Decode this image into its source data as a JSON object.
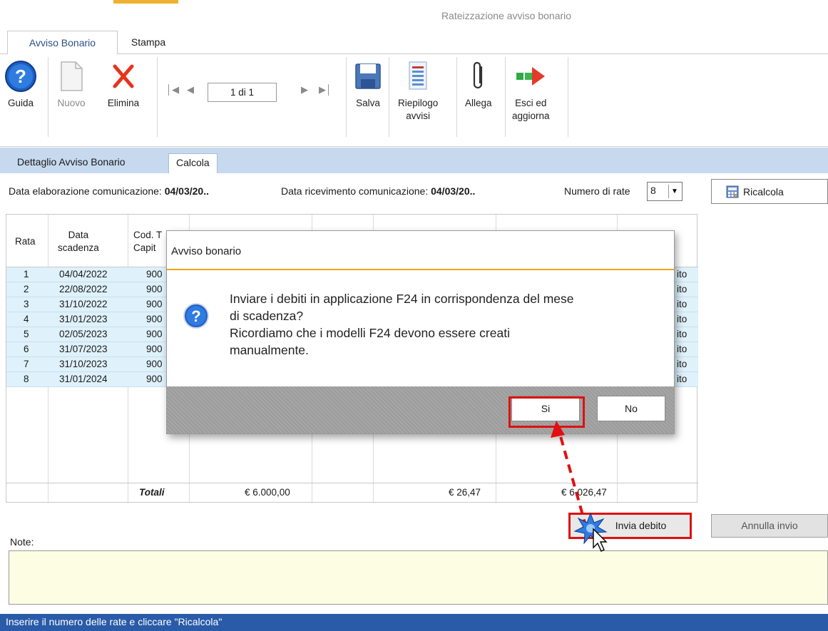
{
  "window": {
    "title": "Rateizzazione avviso bonario"
  },
  "ribbon_tabs": [
    "Avviso Bonario",
    "Stampa"
  ],
  "ribbon": {
    "guida": "Guida",
    "nuovo": "Nuovo",
    "elimina": "Elimina",
    "record_nav": "1 di 1",
    "salva": "Salva",
    "riepilogo_line1": "Riepilogo",
    "riepilogo_line2": "avvisi",
    "allega": "Allega",
    "esci_line1": "Esci ed",
    "esci_line2": "aggiorna"
  },
  "form_tabs": [
    "Dettaglio Avviso Bonario",
    "Calcola"
  ],
  "data_row": {
    "elab_label": "Data elaborazione comunicazione:",
    "elab_value": "04/03/20..",
    "ricev_label": "Data ricevimento comunicazione:",
    "ricev_value": "04/03/20..",
    "rate_label": "Numero di rate",
    "rate_value": "8",
    "ricalcola": "Ricalcola"
  },
  "table": {
    "headers": {
      "rata": "Rata",
      "data_line1": "Data",
      "data_line2": "scadenza",
      "cod_line1": "Cod. T",
      "cod_line2": "Capit"
    },
    "rows": [
      {
        "rata": "1",
        "data": "04/04/2022",
        "cod": "900",
        "tail": "ito"
      },
      {
        "rata": "2",
        "data": "22/08/2022",
        "cod": "900",
        "tail": "ito"
      },
      {
        "rata": "3",
        "data": "31/10/2022",
        "cod": "900",
        "tail": "ito"
      },
      {
        "rata": "4",
        "data": "31/01/2023",
        "cod": "900",
        "tail": "ito"
      },
      {
        "rata": "5",
        "data": "02/05/2023",
        "cod": "900",
        "tail": "ito"
      },
      {
        "rata": "6",
        "data": "31/07/2023",
        "cod": "900",
        "tail": "ito"
      },
      {
        "rata": "7",
        "data": "31/10/2023",
        "cod": "900",
        "tail": "ito"
      },
      {
        "rata": "8",
        "data": "31/01/2024",
        "cod": "900",
        "tail": "ito"
      }
    ],
    "totals": {
      "label": "Totali",
      "capitale": "€ 6.000,00",
      "interessi": "€ 26,47",
      "totale": "€ 6.026,47"
    }
  },
  "buttons": {
    "invia_debito": "Invia debito",
    "annulla_invio": "Annulla invio"
  },
  "note": {
    "label": "Note:"
  },
  "status": {
    "text": "Inserire il numero delle rate e cliccare \"Ricalcola\""
  },
  "dialog": {
    "title": "Avviso bonario",
    "message_line1": "Inviare i debiti in applicazione F24 in corrispondenza del mese",
    "message_line2": "di scadenza?",
    "message_line3": "Ricordiamo che i modelli F24 devono essere creati",
    "message_line4": "manualmente.",
    "yes": "Si",
    "no": "No"
  },
  "colors": {
    "accent_blue": "#2a5ba8",
    "tab_strip": "#c6d9ef",
    "row_highlight": "#dff1fb",
    "highlight_red": "#e01010",
    "dialog_rule": "#f0a21a"
  }
}
